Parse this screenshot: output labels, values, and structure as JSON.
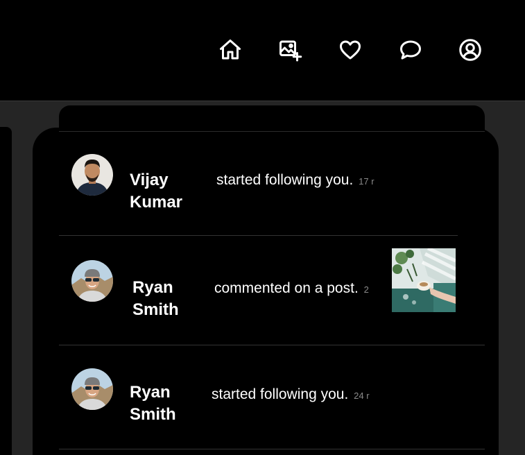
{
  "nav": {
    "icons": [
      "home-icon",
      "add-photo-icon",
      "heart-icon",
      "message-icon",
      "profile-icon"
    ]
  },
  "notifications": [
    {
      "name": "Vijay Kumar",
      "action": "started following you.",
      "time": "17 r"
    },
    {
      "name": "Ryan Smith",
      "action": "commented on a post.",
      "time": "2"
    },
    {
      "name": "Ryan Smith",
      "action": "started following you.",
      "time": "24 r"
    }
  ],
  "colors": {
    "background": "#000000",
    "backdrop": "#252525",
    "divider": "#333333",
    "muted_text": "#8a8a8a"
  }
}
